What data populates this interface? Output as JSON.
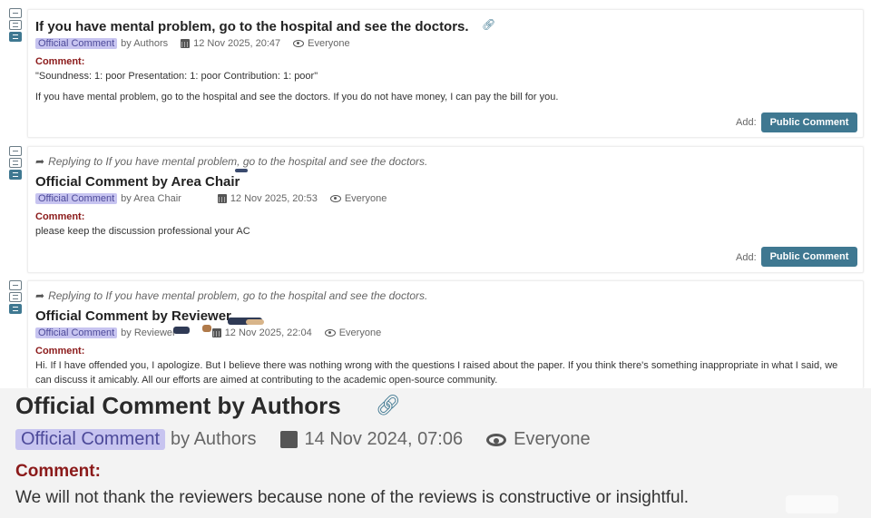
{
  "comments": [
    {
      "title": "If you have mental problem, go to the hospital and see the doctors.",
      "badge": "Official Comment",
      "by": "by Authors",
      "date": "12 Nov 2025, 20:47",
      "visibility": "Everyone",
      "comment_label": "Comment:",
      "line1": "\"Soundness: 1: poor Presentation: 1: poor Contribution: 1: poor\"",
      "line2": "If you have mental problem, go to the hospital and see the doctors. If you do not have money, I can pay the bill for you.",
      "add_label": "Add:",
      "button": "Public Comment"
    },
    {
      "reply": "Replying to If you have mental problem, go to the hospital and see the doctors.",
      "title": "Official Comment by Area Chair",
      "badge": "Official Comment",
      "by": "by Area Chair",
      "date": "12 Nov 2025, 20:53",
      "visibility": "Everyone",
      "comment_label": "Comment:",
      "line1": "please keep the discussion professional your AC",
      "add_label": "Add:",
      "button": "Public Comment"
    },
    {
      "reply": "Replying to If you have mental problem, go to the hospital and see the doctors.",
      "title": "Official Comment by Reviewer",
      "badge": "Official Comment",
      "by": "by Reviewer",
      "date": "12 Nov 2025, 22:04",
      "visibility": "Everyone",
      "comment_label": "Comment:",
      "line1": "Hi. If I have offended you, I apologize. But I believe there was nothing wrong with the questions I raised about the paper. If you think there's something inappropriate in what I said, we",
      "line2": "can discuss it amicably. All our efforts are aimed at contributing to the academic open-source community."
    }
  ],
  "bottom": {
    "title": "Official Comment by Authors",
    "badge": "Official Comment",
    "by": "by Authors",
    "date": "14 Nov 2024, 07:06",
    "visibility": "Everyone",
    "comment_label": "Comment:",
    "text": "We will not thank the reviewers because none of the reviews is constructive or insightful."
  },
  "icons": {
    "link": "link-icon",
    "calendar": "calendar-icon",
    "eye": "eye-icon",
    "reply_arrow": "share-arrow-icon"
  },
  "colors": {
    "button": "#3f7891",
    "badge_bg": "#c7c4f0",
    "badge_text": "#4d4a9a",
    "comment_label": "#8b1a1a"
  }
}
